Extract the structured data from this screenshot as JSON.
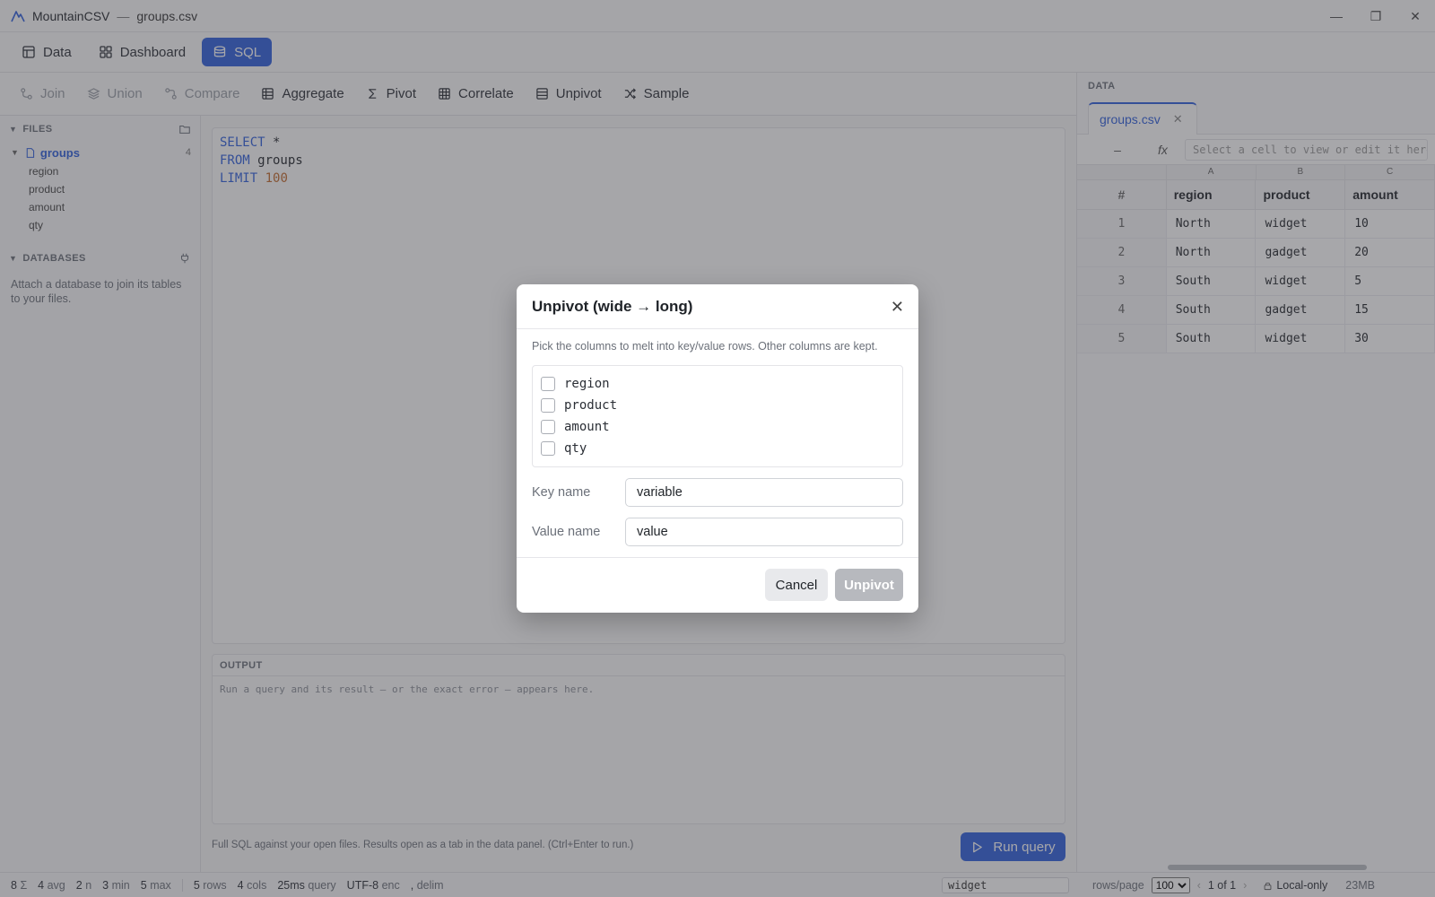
{
  "window": {
    "app_name": "MountainCSV",
    "separator": "—",
    "file_name": "groups.csv",
    "controls": [
      "—",
      "❐",
      "✕"
    ]
  },
  "nav": {
    "tabs": [
      {
        "label": "Data",
        "icon": "table-icon"
      },
      {
        "label": "Dashboard",
        "icon": "grid-icon"
      },
      {
        "label": "SQL",
        "icon": "database-icon",
        "active": true
      }
    ]
  },
  "toolbar": {
    "items": [
      {
        "label": "Join",
        "icon": "join-icon",
        "disabled": true
      },
      {
        "label": "Union",
        "icon": "layers-icon",
        "disabled": true
      },
      {
        "label": "Compare",
        "icon": "compare-icon",
        "disabled": true
      },
      {
        "label": "Aggregate",
        "icon": "table-icon"
      },
      {
        "label": "Pivot",
        "icon": "sigma-icon"
      },
      {
        "label": "Correlate",
        "icon": "table-icon"
      },
      {
        "label": "Unpivot",
        "icon": "rows-icon"
      },
      {
        "label": "Sample",
        "icon": "shuffle-icon"
      }
    ]
  },
  "sidebar": {
    "files_header": "FILES",
    "file": {
      "name": "groups",
      "count": "4"
    },
    "columns": [
      "region",
      "product",
      "amount",
      "qty"
    ],
    "databases_header": "DATABASES",
    "databases_hint": "Attach a database to join its tables to your files."
  },
  "editor": {
    "line1_kw": "SELECT",
    "line1_rest": " *",
    "line2_kw": "FROM",
    "line2_rest": " groups",
    "line3_kw": "LIMIT",
    "line3_num": " 100"
  },
  "output": {
    "header": "OUTPUT",
    "placeholder": "Run a query and its result — or the exact error — appears here."
  },
  "footnote": "Full SQL against your open files. Results open as a tab in the data panel. (Ctrl+Enter to run.)",
  "run_button": "Run query",
  "data_panel": {
    "header": "DATA",
    "tab_label": "groups.csv",
    "tab_close": "✕",
    "cell_ref": "–",
    "fx": "fx",
    "formula_placeholder": "Select a cell to view or edit it here",
    "col_letters": [
      "A",
      "B",
      "C"
    ],
    "headers": [
      "#",
      "region",
      "product",
      "amount"
    ],
    "rows": [
      [
        "1",
        "North",
        "widget",
        "10"
      ],
      [
        "2",
        "North",
        "gadget",
        "20"
      ],
      [
        "3",
        "South",
        "widget",
        "5"
      ],
      [
        "4",
        "South",
        "gadget",
        "15"
      ],
      [
        "5",
        "South",
        "widget",
        "30"
      ]
    ]
  },
  "status": {
    "sum_n": "8",
    "sum_label": "Σ",
    "avg_n": "4",
    "avg_label": "avg",
    "count_n": "2",
    "count_label": "n",
    "min_n": "3",
    "min_label": "min",
    "max_n": "5",
    "max_label": "max",
    "rows_n": "5",
    "rows_label": "rows",
    "cols_n": "4",
    "cols_label": "cols",
    "query_n": "25ms",
    "query_label": "query",
    "enc_n": "UTF-8",
    "enc_label": "enc",
    "delim_n": ",",
    "delim_label": "delim",
    "find_value": "widget",
    "rows_per_page_label": "rows/page",
    "rows_per_page": "100",
    "page": "1 of 1",
    "local_only": "Local-only",
    "memory": "23MB"
  },
  "modal": {
    "title": "Unpivot (wide → long)",
    "close": "✕",
    "description": "Pick the columns to melt into key/value rows. Other columns are kept.",
    "columns": [
      "region",
      "product",
      "amount",
      "qty"
    ],
    "key_label": "Key name",
    "key_value": "variable",
    "value_label": "Value name",
    "value_value": "value",
    "cancel": "Cancel",
    "submit": "Unpivot"
  },
  "colors": {
    "accent": "#2f5fdc",
    "disabled": "#b7b9be"
  }
}
